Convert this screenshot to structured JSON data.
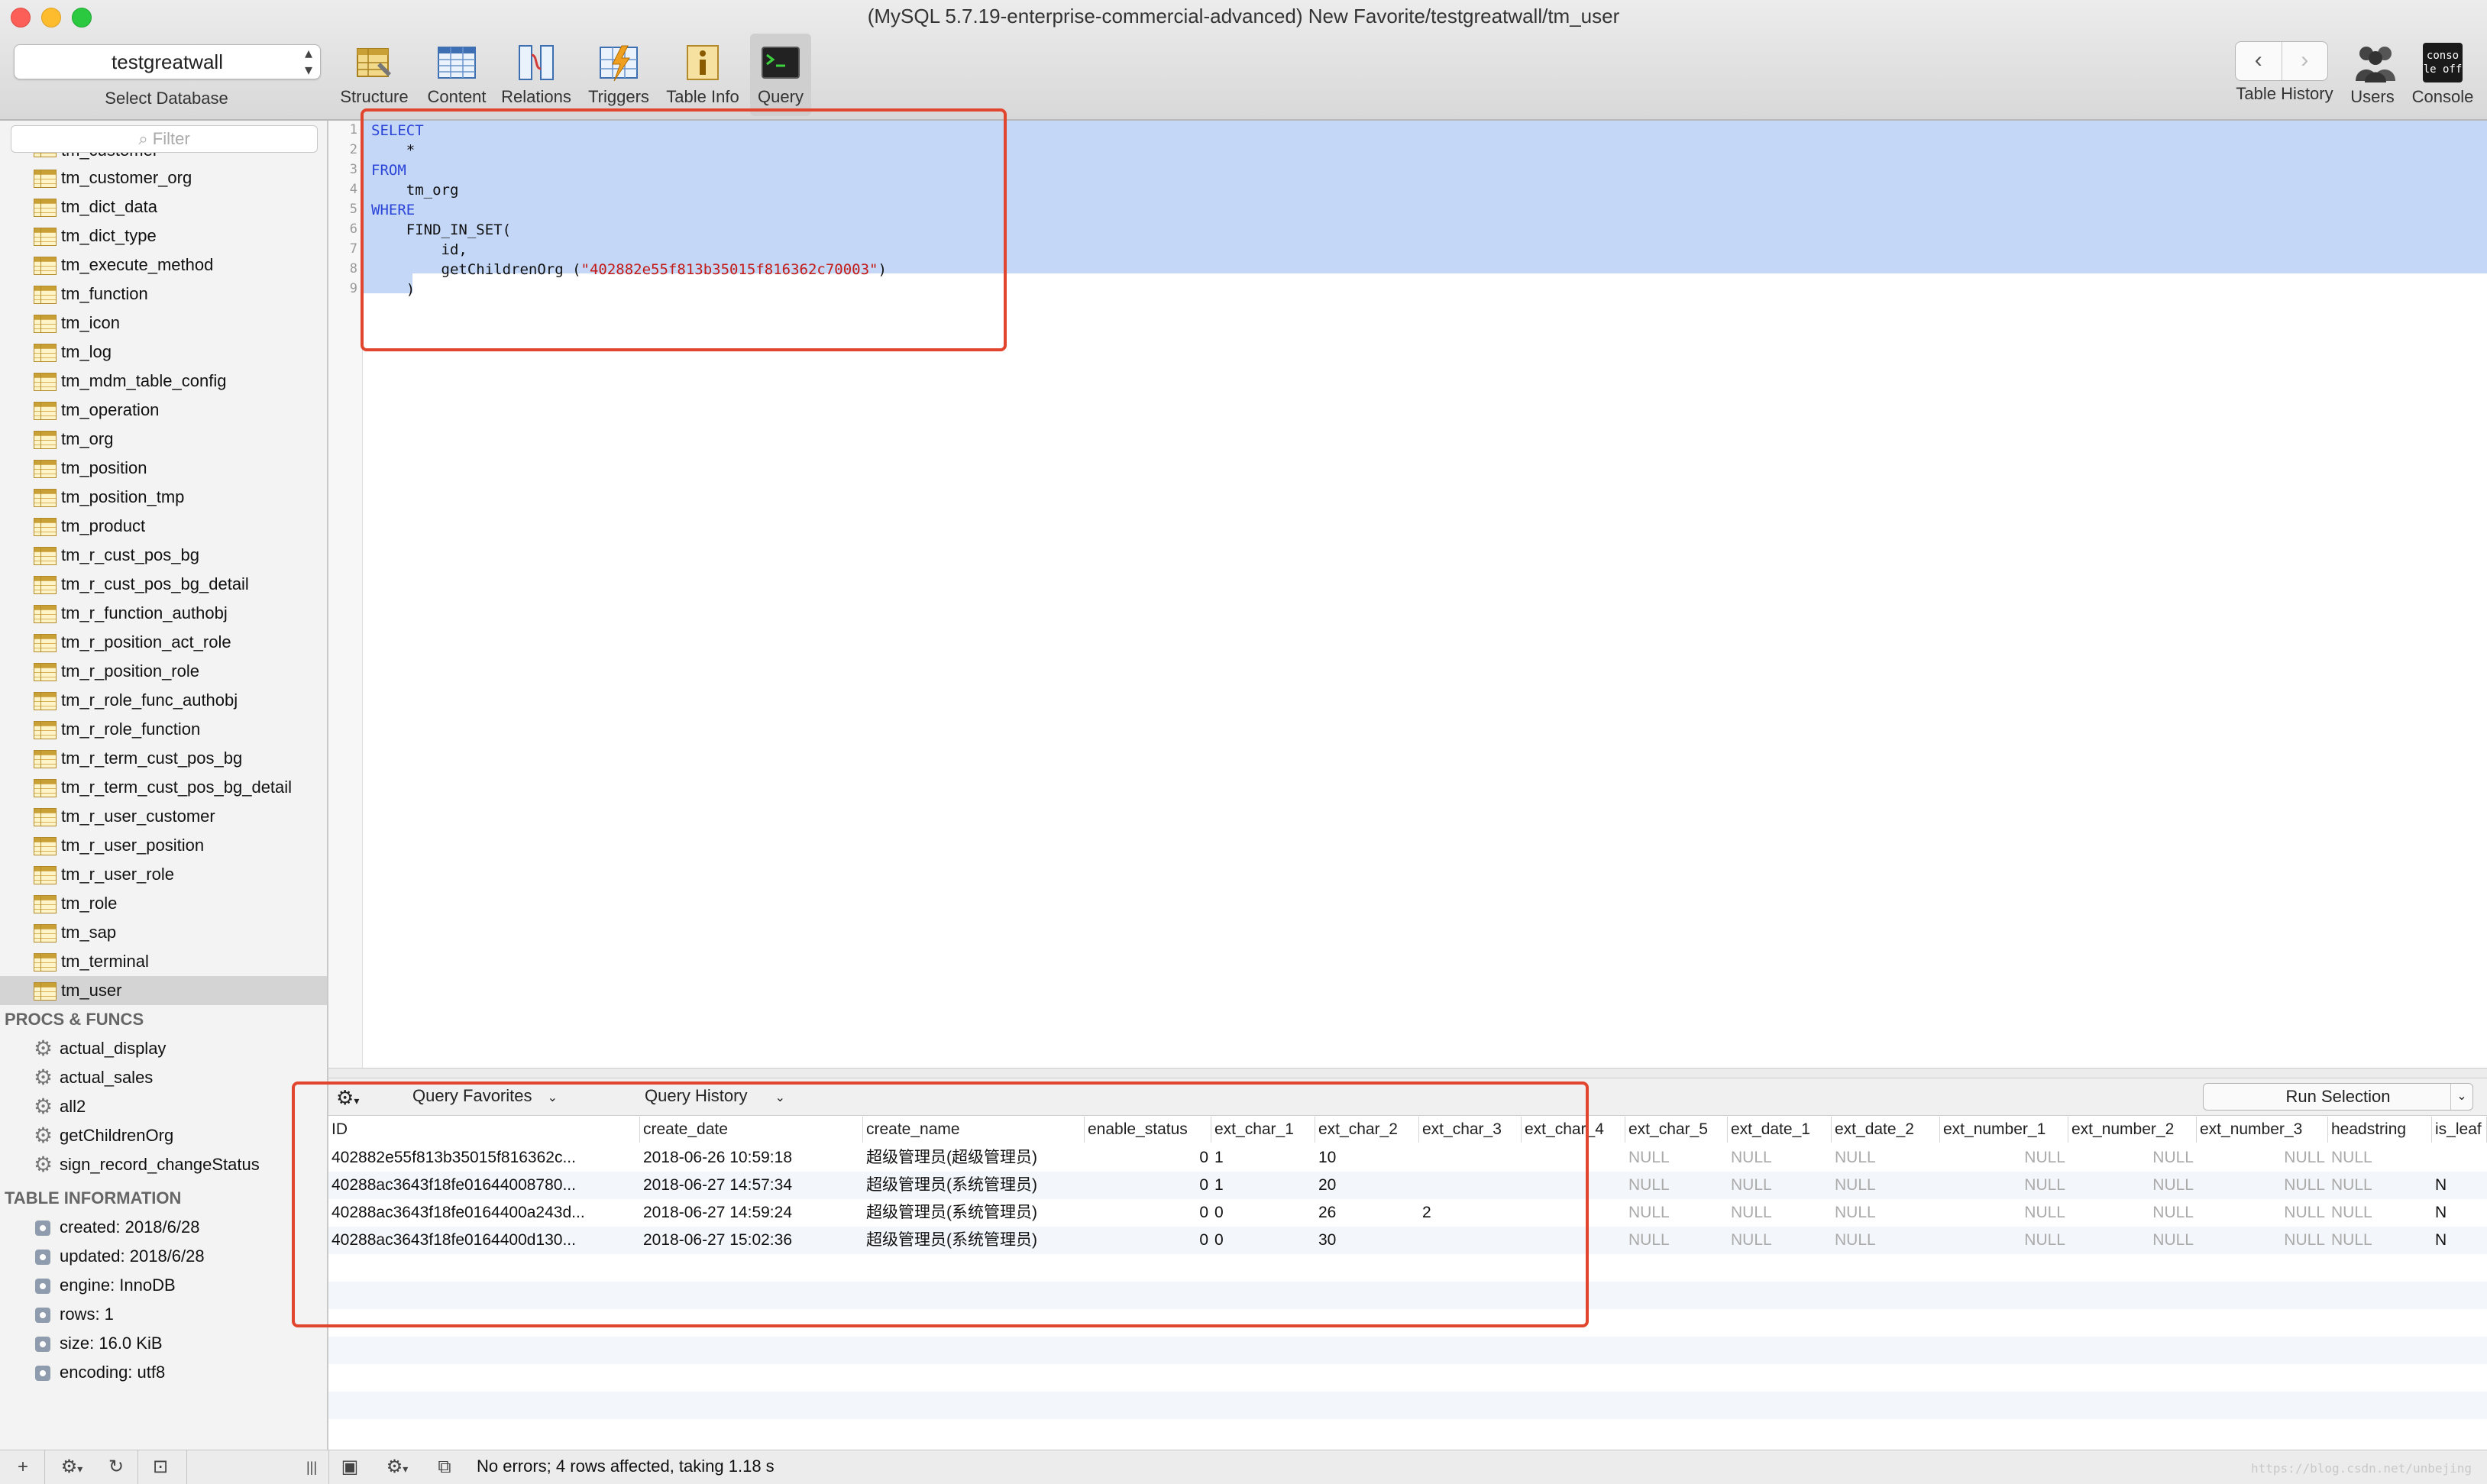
{
  "window": {
    "title": "(MySQL 5.7.19-enterprise-commercial-advanced) New Favorite/testgreatwall/tm_user"
  },
  "toolbar": {
    "database": "testgreatwall",
    "database_label": "Select Database",
    "tools": [
      {
        "label": "Structure",
        "icon": "structure-icon"
      },
      {
        "label": "Content",
        "icon": "content-icon"
      },
      {
        "label": "Relations",
        "icon": "relations-icon"
      },
      {
        "label": "Triggers",
        "icon": "triggers-icon"
      },
      {
        "label": "Table Info",
        "icon": "table-info-icon"
      },
      {
        "label": "Query",
        "icon": "query-icon",
        "active": true
      }
    ],
    "right": {
      "back": "‹",
      "forward": "›",
      "history_label": "Table History",
      "users_label": "Users",
      "console_label": "Console",
      "console_icon_text": "conso\nle off"
    }
  },
  "sidebar": {
    "filter_placeholder": "Filter",
    "tables": [
      "tm_customer",
      "tm_customer_org",
      "tm_dict_data",
      "tm_dict_type",
      "tm_execute_method",
      "tm_function",
      "tm_icon",
      "tm_log",
      "tm_mdm_table_config",
      "tm_operation",
      "tm_org",
      "tm_position",
      "tm_position_tmp",
      "tm_product",
      "tm_r_cust_pos_bg",
      "tm_r_cust_pos_bg_detail",
      "tm_r_function_authobj",
      "tm_r_position_act_role",
      "tm_r_position_role",
      "tm_r_role_func_authobj",
      "tm_r_role_function",
      "tm_r_term_cust_pos_bg",
      "tm_r_term_cust_pos_bg_detail",
      "tm_r_user_customer",
      "tm_r_user_position",
      "tm_r_user_role",
      "tm_role",
      "tm_sap",
      "tm_terminal",
      "tm_user"
    ],
    "selected_table": "tm_user",
    "procs_header": "PROCS & FUNCS",
    "procs": [
      "actual_display",
      "actual_sales",
      "all2",
      "getChildrenOrg",
      "sign_record_changeStatus"
    ],
    "info_header": "TABLE INFORMATION",
    "info": [
      "created: 2018/6/28",
      "updated: 2018/6/28",
      "engine: InnoDB",
      "rows: 1",
      "size: 16.0 KiB",
      "encoding: utf8"
    ]
  },
  "editor": {
    "line_numbers": [
      "1",
      "2",
      "3",
      "4",
      "5",
      "6",
      "7",
      "8",
      "9"
    ],
    "lines": [
      {
        "kw": "SELECT",
        "text": ""
      },
      {
        "kw": "",
        "text": "    *"
      },
      {
        "kw": "FROM",
        "text": ""
      },
      {
        "kw": "",
        "text": "    tm_org"
      },
      {
        "kw": "WHERE",
        "text": ""
      },
      {
        "kw": "",
        "text": "    FIND_IN_SET("
      },
      {
        "kw": "",
        "text": "        id,"
      },
      {
        "kw": "",
        "text": "        getChildrenOrg (",
        "str": "\"402882e55f813b35015f816362c70003\"",
        "tail": ")"
      },
      {
        "kw": "",
        "text": "    )"
      }
    ]
  },
  "results": {
    "favorites_label": "Query Favorites",
    "history_label": "Query History",
    "run_label": "Run Selection",
    "columns": [
      "ID",
      "create_date",
      "create_name",
      "enable_status",
      "ext_char_1",
      "ext_char_2",
      "ext_char_3",
      "ext_char_4",
      "ext_char_5",
      "ext_date_1",
      "ext_date_2",
      "ext_number_1",
      "ext_number_2",
      "ext_number_3",
      "headstring",
      "is_leaf"
    ],
    "rows": [
      [
        "402882e55f813b35015f816362c...",
        "2018-06-26 10:59:18",
        "超级管理员(超级管理员)",
        "0",
        "1",
        "10",
        "",
        "",
        "NULL",
        "NULL",
        "NULL",
        "NULL",
        "NULL",
        "NULL",
        "NULL",
        ""
      ],
      [
        "40288ac3643f18fe01644008780...",
        "2018-06-27 14:57:34",
        "超级管理员(系统管理员)",
        "0",
        "1",
        "20",
        "",
        "",
        "NULL",
        "NULL",
        "NULL",
        "NULL",
        "NULL",
        "NULL",
        "NULL",
        "N"
      ],
      [
        "40288ac3643f18fe0164400a243d...",
        "2018-06-27 14:59:24",
        "超级管理员(系统管理员)",
        "0",
        "0",
        "26",
        "2",
        "",
        "NULL",
        "NULL",
        "NULL",
        "NULL",
        "NULL",
        "NULL",
        "NULL",
        "N"
      ],
      [
        "40288ac3643f18fe0164400d130...",
        "2018-06-27 15:02:36",
        "超级管理员(系统管理员)",
        "0",
        "0",
        "30",
        "",
        "",
        "NULL",
        "NULL",
        "NULL",
        "NULL",
        "NULL",
        "NULL",
        "NULL",
        "N"
      ]
    ]
  },
  "statusbar": {
    "add": "+",
    "status": "No errors; 4 rows affected, taking 1.18 s",
    "watermark": "https://blog.csdn.net/unbejing"
  },
  "colors": {
    "highlight_box": "#e2452d",
    "selection": "#c4d7f7",
    "keyword": "#2b44d8",
    "string": "#c41a16"
  }
}
